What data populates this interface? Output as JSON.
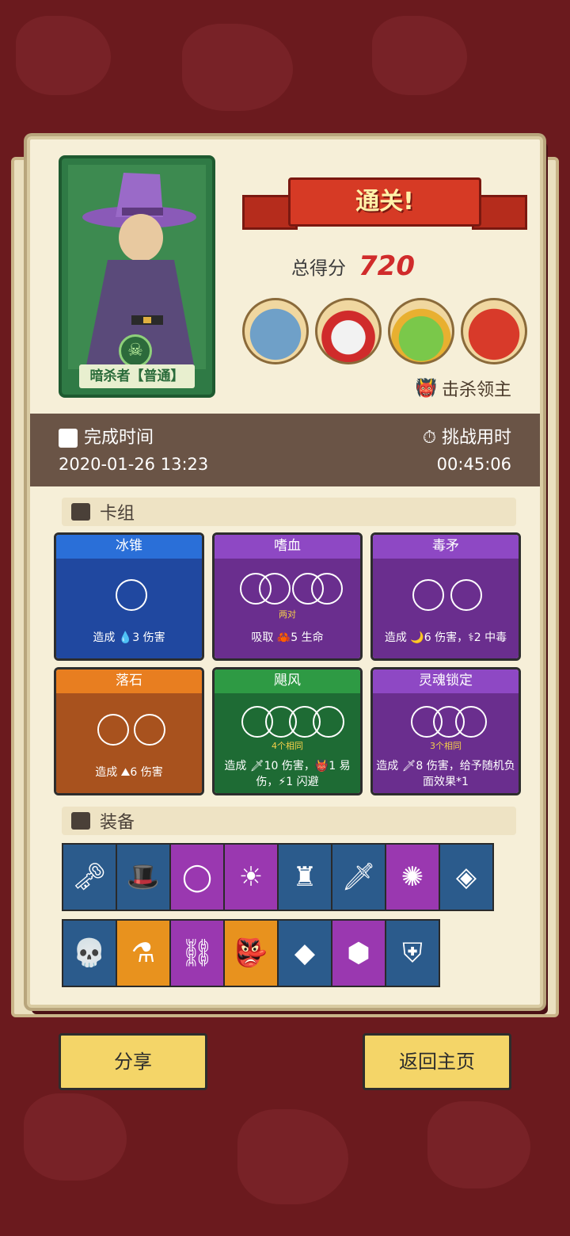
{
  "hero": {
    "name": "暗杀者【普通】",
    "skull_icon": "skull-icon"
  },
  "result": {
    "banner": "通关!",
    "score_label": "总得分",
    "score_value": "720"
  },
  "bosses": [
    "boss-blue-ogre",
    "boss-crowned-skull",
    "boss-green-goblin-king",
    "boss-red-demon"
  ],
  "kill_label": "击杀领主",
  "time": {
    "finish_label": "完成时间",
    "finish_value": "2020-01-26 13:23",
    "duration_label": "挑战用时",
    "duration_value": "00:45:06"
  },
  "deck": {
    "title": "卡组",
    "cards": [
      {
        "name": "冰锥",
        "note": "",
        "desc": "造成 💧3 伤害",
        "color": "#2048a0",
        "title_color": "#2a6fd8"
      },
      {
        "name": "嗜血",
        "note": "两对",
        "desc": "吸取 🦀5 生命",
        "color": "#6a2e8e",
        "title_color": "#8e48c4"
      },
      {
        "name": "毒矛",
        "note": "",
        "desc": "造成 🌙6 伤害，⚕2 中毒",
        "color": "#6a2e8e",
        "title_color": "#8e48c4"
      },
      {
        "name": "落石",
        "note": "",
        "desc": "造成 ⛰6 伤害",
        "color": "#a8521e",
        "title_color": "#e87e20"
      },
      {
        "name": "飓风",
        "note": "4个相同",
        "desc": "造成 🗡10 伤害，👹1 易伤，⚡1 闪避",
        "color": "#1e6b34",
        "title_color": "#2e9a44"
      },
      {
        "name": "灵魂锁定",
        "note": "3个相同",
        "desc": "造成 🗡8 伤害，给予随机负面效果*1",
        "color": "#6a2e8e",
        "title_color": "#8e48c4"
      }
    ]
  },
  "equipment": {
    "title": "装备",
    "row1": [
      {
        "icon": "key-icon",
        "glyph": "🗝",
        "color": "blue"
      },
      {
        "icon": "top-hat-icon",
        "glyph": "🎩",
        "color": "blue"
      },
      {
        "icon": "red-ring-icon",
        "glyph": "◯",
        "color": "purple"
      },
      {
        "icon": "golden-mask-icon",
        "glyph": "☀",
        "color": "purple"
      },
      {
        "icon": "horn-cup-icon",
        "glyph": "♜",
        "color": "blue"
      },
      {
        "icon": "dagger-icon",
        "glyph": "🗡",
        "color": "blue"
      },
      {
        "icon": "slime-icon",
        "glyph": "✺",
        "color": "purple"
      },
      {
        "icon": "emerald-ring-icon",
        "glyph": "◈",
        "color": "blue"
      }
    ],
    "row2": [
      {
        "icon": "skull-icon",
        "glyph": "💀",
        "color": "blue"
      },
      {
        "icon": "eye-flask-icon",
        "glyph": "⚗",
        "color": "orange"
      },
      {
        "icon": "chain-icon",
        "glyph": "⛓",
        "color": "purple"
      },
      {
        "icon": "demon-mask-icon",
        "glyph": "👺",
        "color": "orange"
      },
      {
        "icon": "crystal-icon",
        "glyph": "◆",
        "color": "blue"
      },
      {
        "icon": "dice-icon",
        "glyph": "⬢",
        "color": "purple"
      },
      {
        "icon": "shield-icon",
        "glyph": "⛨",
        "color": "blue"
      }
    ]
  },
  "buttons": {
    "share": "分享",
    "home": "返回主页"
  }
}
